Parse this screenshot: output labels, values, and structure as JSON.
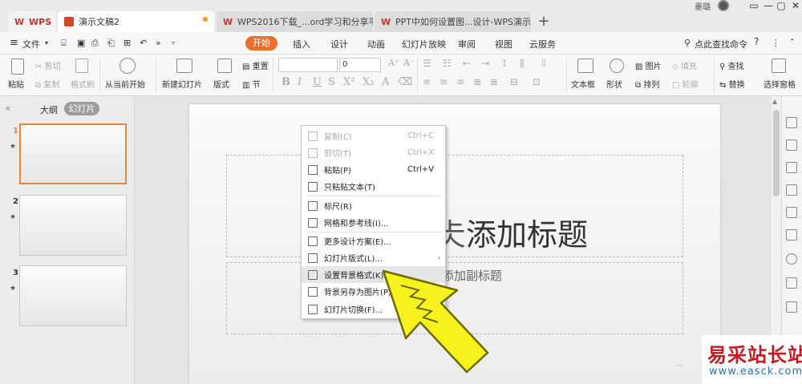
{
  "titlebar": {
    "tabs": [
      {
        "label": "WPS"
      },
      {
        "label": "演示文稿2"
      },
      {
        "label": "WPS2016下载_...ord学习和分享平台"
      },
      {
        "label": "PPT中如何设置图...设计-WPS演示-"
      }
    ],
    "add_tab": "+",
    "user": "墨璐",
    "window_buttons": [
      "▭",
      "—",
      "▢",
      "✕"
    ]
  },
  "menubar": {
    "file": "文件",
    "more": "»",
    "tabs": [
      "开始",
      "插入",
      "设计",
      "动画",
      "幻灯片放映",
      "审阅",
      "视图",
      "云服务"
    ],
    "search_placeholder": "点此查找命令",
    "help": "?"
  },
  "ribbon": {
    "cut": "剪切",
    "paste": "粘贴",
    "copy": "复制",
    "format_painter": "格式刷",
    "from_current": "从当前开始",
    "new_slide": "新建幻灯片",
    "layout": "版式",
    "reset": "重置",
    "section": "节",
    "font_size": "0",
    "textbox": "文本框",
    "shape": "形状",
    "picture": "图片",
    "fill": "填充",
    "arrange": "排列",
    "outline": "轮廓",
    "find": "查找",
    "replace": "替换",
    "select_pane": "选择窗格"
  },
  "leftpanel": {
    "outline_tab": "大纲",
    "slides_tab": "幻灯片",
    "collapse": "«",
    "slides": [
      {
        "num": "1"
      },
      {
        "num": "2"
      },
      {
        "num": "3"
      }
    ],
    "star": "★"
  },
  "slide": {
    "title": "单击此处添加标题",
    "title_visible": "添加标题",
    "title_partial": "仧",
    "subtitle": "添加副标题"
  },
  "context_menu": {
    "items": [
      {
        "label": "复制(C)",
        "shortcut": "Ctrl+C",
        "disabled": true
      },
      {
        "label": "剪切(T)",
        "shortcut": "Ctrl+X",
        "disabled": true
      },
      {
        "label": "粘贴(P)",
        "shortcut": "Ctrl+V",
        "disabled": false
      },
      {
        "label": "只粘贴文本(T)",
        "shortcut": "",
        "disabled": false
      },
      {
        "label": "标尺(R)",
        "shortcut": "",
        "disabled": false
      },
      {
        "label": "网格和参考线(I)...",
        "shortcut": "",
        "disabled": false
      },
      {
        "label": "更多设计方案(E)...",
        "shortcut": "",
        "disabled": false
      },
      {
        "label": "幻灯片版式(L)...",
        "shortcut": "",
        "disabled": false,
        "submenu": true
      },
      {
        "label": "设置背景格式(K)...",
        "shortcut": "",
        "disabled": false,
        "highlighted": true
      },
      {
        "label": "背景另存为图片(P)...",
        "shortcut": "",
        "disabled": false
      },
      {
        "label": "幻灯片切换(F)...",
        "shortcut": "",
        "disabled": false
      }
    ],
    "submenu_arrow": "›"
  },
  "watermark": {
    "title": "易采站长站",
    "url": "www.easck.com"
  },
  "colors": {
    "accent": "#e9712d",
    "highlight_arrow": "#f7f21e",
    "watermark_red": "#c5181f"
  }
}
